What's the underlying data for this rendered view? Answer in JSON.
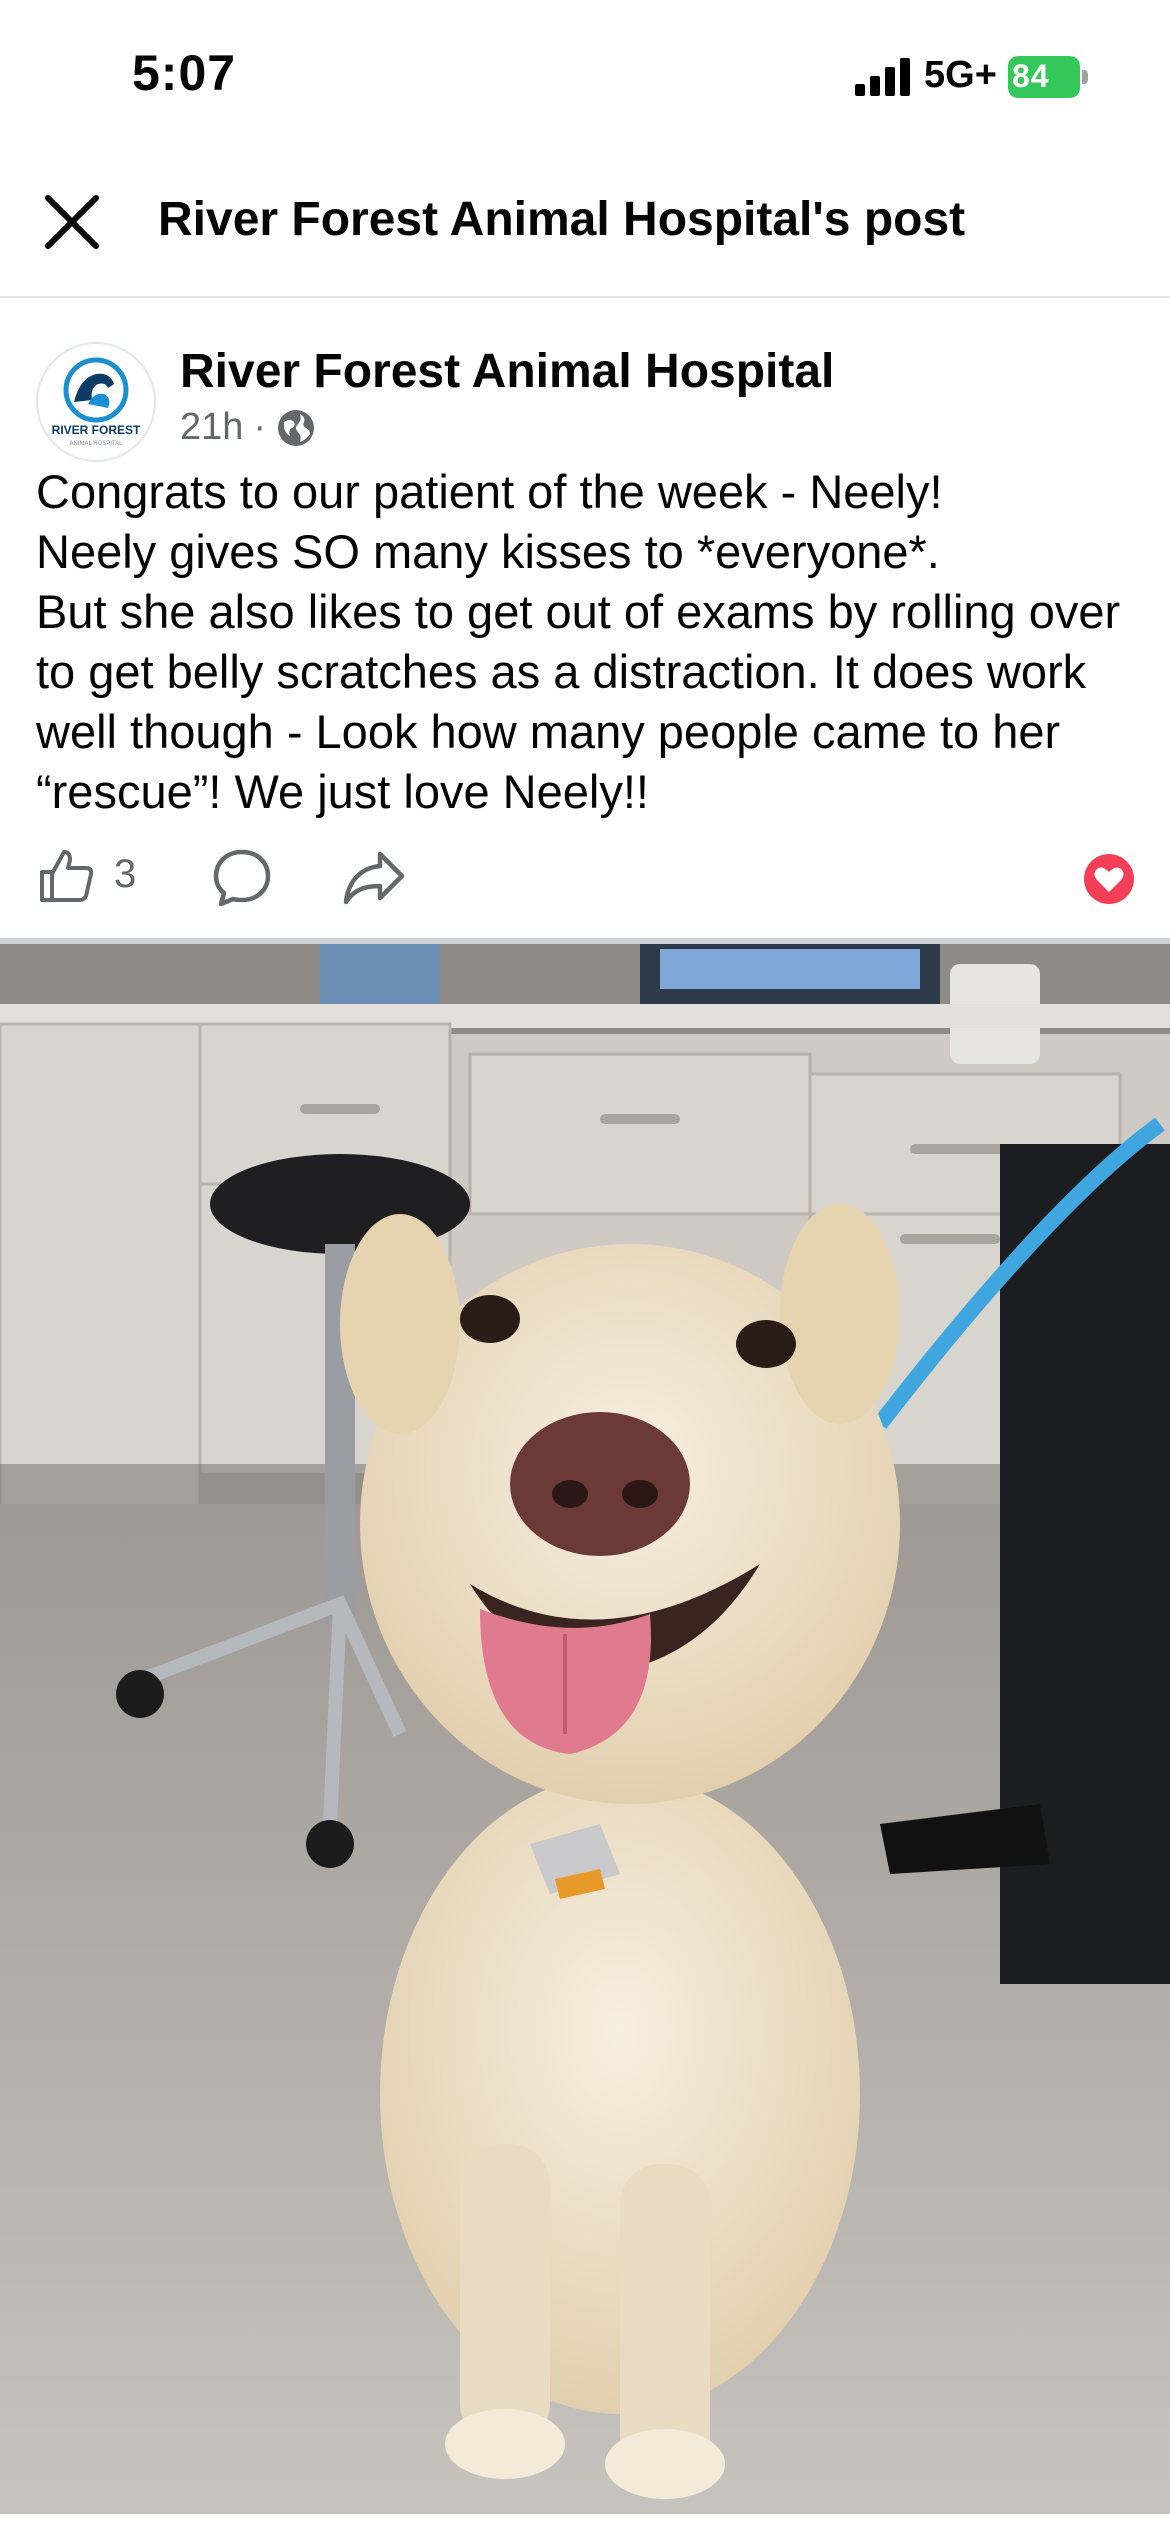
{
  "status_bar": {
    "time": "5:07",
    "network": "5G+",
    "battery": "84"
  },
  "header": {
    "title": "River Forest Animal Hospital's post",
    "close_icon": "close-icon"
  },
  "post": {
    "page_name": "River Forest Animal Hospital",
    "avatar_text": "RIVER FOREST",
    "avatar_subtext": "ANIMAL HOSPITAL",
    "time_ago": "21h",
    "separator": "·",
    "audience_icon": "globe-icon",
    "text": "Congrats to our patient of the week - Neely!\nNeely gives SO many kisses to *everyone*.\nBut she also likes to get out of exams by rolling over to get belly scratches as a distraction.  It does work well though - Look how many people came to her “rescue”!  We just love Neely!!",
    "like_count": "3"
  },
  "colors": {
    "reaction": "#f33e58",
    "battery": "#34c759",
    "secondary_text": "#65676b",
    "logo_blue": "#1b8fd0"
  }
}
